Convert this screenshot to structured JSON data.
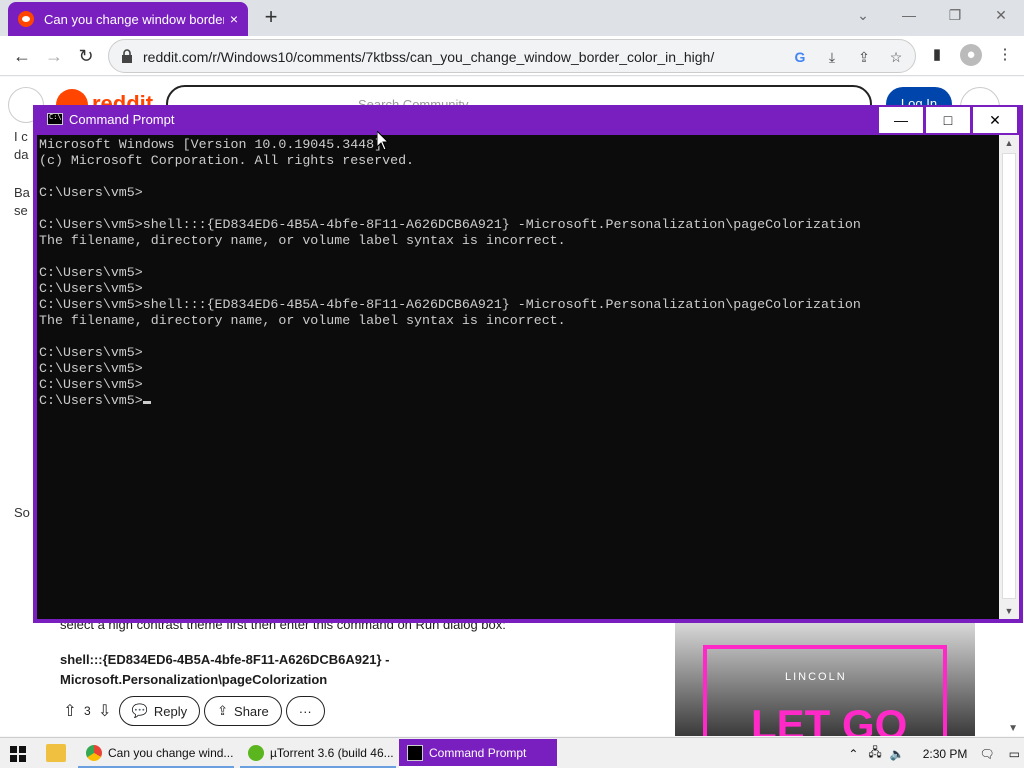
{
  "browser": {
    "tab_title": "Can you change window border color in high contrast?",
    "tab_close": "×",
    "new_tab": "+",
    "window_controls": [
      "⌄",
      "—",
      "❐",
      "✕"
    ],
    "url": "reddit.com/r/Windows10/comments/7ktbss/can_you_change_window_border_color_in_high/"
  },
  "reddit": {
    "logo_text": "reddit",
    "search_placeholder": "Search Community",
    "login_label": "Log In",
    "left_fragments": [
      "I c",
      "da",
      "Ba",
      "se",
      "So"
    ],
    "comment": {
      "line1": "select a high contrast theme first then enter this command on Run dialog box:",
      "command": "shell:::{ED834ED6-4B5A-4bfe-8F11-A626DCB6A921} -Microsoft.Personalization\\pageColorization",
      "votes": "3",
      "reply_label": "Reply",
      "share_label": "Share",
      "more_label": "···"
    },
    "ad": {
      "brand": "LINCOLN",
      "tagline": "LET GO"
    }
  },
  "cmd": {
    "title": "Command Prompt",
    "minimize": "—",
    "maximize": "□",
    "close": "✕",
    "lines": [
      "Microsoft Windows [Version 10.0.19045.3448]",
      "(c) Microsoft Corporation. All rights reserved.",
      "",
      "C:\\Users\\vm5>",
      "",
      "C:\\Users\\vm5>shell:::{ED834ED6-4B5A-4bfe-8F11-A626DCB6A921} -Microsoft.Personalization\\pageColorization",
      "The filename, directory name, or volume label syntax is incorrect.",
      "",
      "C:\\Users\\vm5>",
      "C:\\Users\\vm5>",
      "C:\\Users\\vm5>shell:::{ED834ED6-4B5A-4bfe-8F11-A626DCB6A921} -Microsoft.Personalization\\pageColorization",
      "The filename, directory name, or volume label syntax is incorrect.",
      "",
      "C:\\Users\\vm5>",
      "C:\\Users\\vm5>",
      "C:\\Users\\vm5>",
      "C:\\Users\\vm5>"
    ]
  },
  "taskbar": {
    "items": [
      {
        "label": "Can you change wind...",
        "icon": "chrome-icon"
      },
      {
        "label": "µTorrent 3.6  (build 46...",
        "icon": "utorrent-icon"
      },
      {
        "label": "Command Prompt",
        "icon": "cmd-icon"
      }
    ],
    "time": "2:30 PM"
  },
  "colors": {
    "accent": "#7a1fbf",
    "reddit_orange": "#ff4500",
    "console_bg": "#0c0c0c",
    "console_fg": "#cccccc"
  }
}
